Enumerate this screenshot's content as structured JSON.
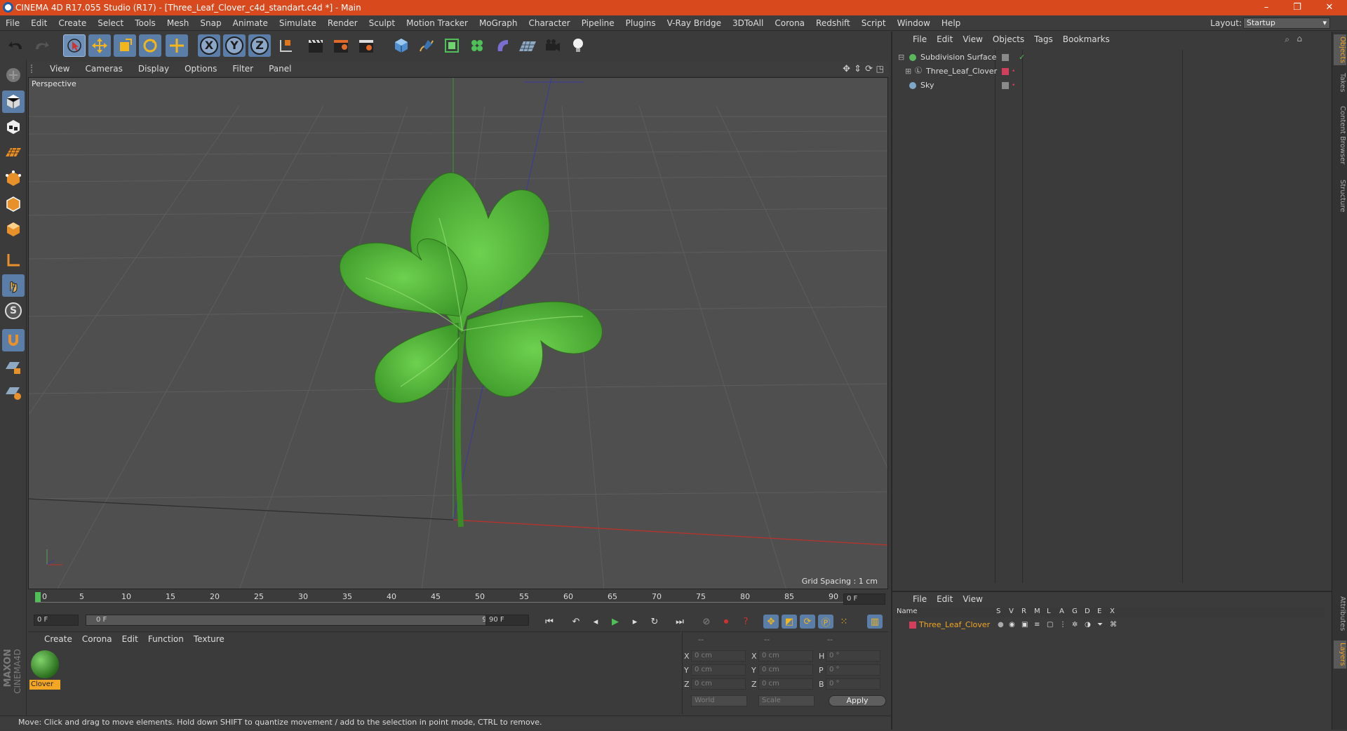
{
  "window": {
    "title": "CINEMA 4D R17.055 Studio (R17) - [Three_Leaf_Clover_c4d_standart.c4d *] - Main",
    "minimize": "–",
    "restore": "❐",
    "close": "✕"
  },
  "menu": [
    "File",
    "Edit",
    "Create",
    "Select",
    "Tools",
    "Mesh",
    "Snap",
    "Animate",
    "Simulate",
    "Render",
    "Sculpt",
    "Motion Tracker",
    "MoGraph",
    "Character",
    "Pipeline",
    "Plugins",
    "V-Ray Bridge",
    "3DToAll",
    "Corona",
    "Redshift",
    "Script",
    "Window",
    "Help"
  ],
  "layout": {
    "label": "Layout:",
    "value": "Startup"
  },
  "toolbar": {
    "axis_x": "X",
    "axis_y": "Y",
    "axis_z": "Z"
  },
  "left_tools": {
    "snap_icon_label": "S"
  },
  "viewport": {
    "menu": [
      "View",
      "Cameras",
      "Display",
      "Options",
      "Filter",
      "Panel"
    ],
    "label": "Perspective",
    "grid_spacing": "Grid Spacing : 1 cm"
  },
  "timeline": {
    "ticks": [
      "0",
      "5",
      "10",
      "15",
      "20",
      "25",
      "30",
      "35",
      "40",
      "45",
      "50",
      "55",
      "60",
      "65",
      "70",
      "75",
      "80",
      "85",
      "90"
    ],
    "current_frame": "0 F",
    "start_field": "0 F",
    "range_start": "0 F",
    "range_end": "90 F",
    "end_field": "90 F"
  },
  "materials": {
    "menu": [
      "Create",
      "Corona",
      "Edit",
      "Function",
      "Texture"
    ],
    "items": [
      {
        "name": "Clover"
      }
    ]
  },
  "coords": {
    "headers": [
      "--",
      "--",
      "--"
    ],
    "rows": [
      {
        "axis1": "X",
        "val1": "0 cm",
        "axis2": "X",
        "val2": "0 cm",
        "axis3": "H",
        "val3": "0 °"
      },
      {
        "axis1": "Y",
        "val1": "0 cm",
        "axis2": "Y",
        "val2": "0 cm",
        "axis3": "P",
        "val3": "0 °"
      },
      {
        "axis1": "Z",
        "val1": "0 cm",
        "axis2": "Z",
        "val2": "0 cm",
        "axis3": "B",
        "val3": "0 °"
      }
    ],
    "mode_world": "World",
    "mode_scale": "Scale",
    "apply": "Apply"
  },
  "status": "Move: Click and drag to move elements. Hold down SHIFT to quantize movement / add to the selection in point mode, CTRL to remove.",
  "objects": {
    "menu": [
      "File",
      "Edit",
      "View",
      "Objects",
      "Tags",
      "Bookmarks"
    ],
    "items": [
      {
        "name": "Subdivision Surface",
        "color": "#5bb85b"
      },
      {
        "name": "Three_Leaf_Clover",
        "color": "#d23f5b"
      },
      {
        "name": "Sky",
        "color": "#7fa6c9"
      }
    ]
  },
  "layers": {
    "menu": [
      "File",
      "Edit",
      "View"
    ],
    "columns": [
      "Name",
      "S",
      "V",
      "R",
      "M",
      "L",
      "A",
      "G",
      "D",
      "E",
      "X"
    ],
    "items": [
      {
        "name": "Three_Leaf_Clover",
        "color": "#d23f5b"
      }
    ]
  },
  "side_tabs": [
    "Objects",
    "Takes",
    "Content Browser",
    "Structure",
    "Attributes",
    "Layers"
  ],
  "brand": {
    "maxon": "MAXON",
    "product": "CINEMA4D"
  }
}
